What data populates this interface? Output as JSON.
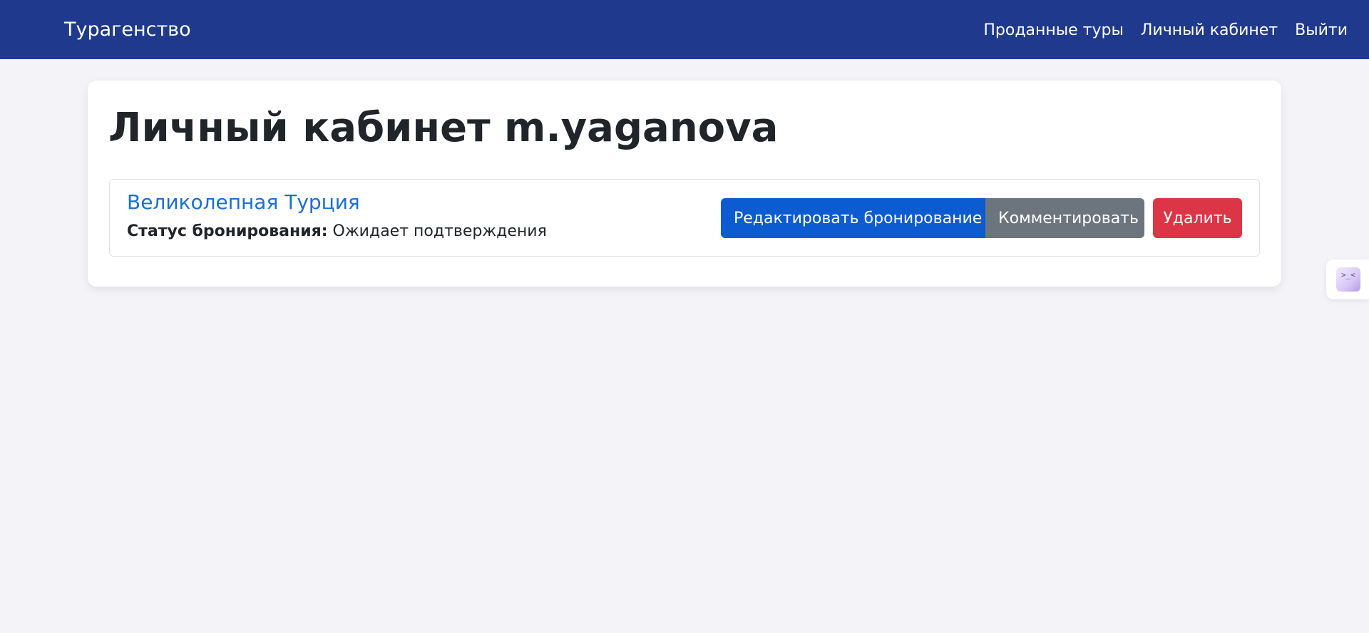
{
  "navbar": {
    "brand": "Турагенство",
    "links": [
      {
        "label": "Проданные туры"
      },
      {
        "label": "Личный кабинет"
      },
      {
        "label": "Выйти"
      }
    ],
    "background_color": "#1f3a8c"
  },
  "main": {
    "title": "Личный кабинет m.yaganova",
    "bookings": [
      {
        "tour_name": "Великолепная Турция",
        "status_label": "Статус бронирования:",
        "status_value": "Ожидает подтверждения",
        "actions": {
          "edit_label": "Редактировать бронирование",
          "comment_label": "Комментировать",
          "delete_label": "Удалить"
        }
      }
    ]
  },
  "colors": {
    "primary": "#0d5bd1",
    "secondary": "#6c757d",
    "danger": "#dc3545",
    "link": "#1a6fd6",
    "page_background": "#f3f3f8"
  },
  "side_widget": {
    "icon": "assistant-icon",
    "glyph": ">_<"
  }
}
